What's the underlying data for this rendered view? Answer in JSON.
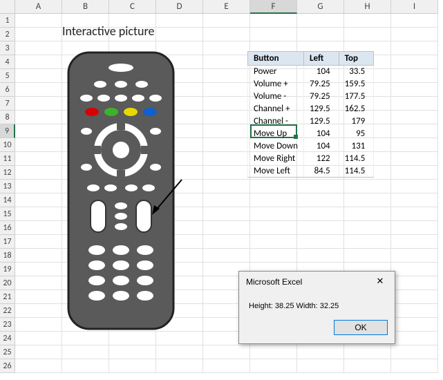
{
  "columns": [
    "A",
    "B",
    "C",
    "D",
    "E",
    "F",
    "G",
    "H",
    "I"
  ],
  "rowCount": 26,
  "activeCol": 5,
  "activeRow": 8,
  "title": "Interactive picture",
  "table": {
    "headers": [
      "Button",
      "Left",
      "Top"
    ],
    "rows": [
      {
        "button": "Power",
        "left": "104",
        "top": "33.5"
      },
      {
        "button": "Volume +",
        "left": "79.25",
        "top": "159.5"
      },
      {
        "button": "Volume -",
        "left": "79.25",
        "top": "177.5"
      },
      {
        "button": "Channel +",
        "left": "129.5",
        "top": "162.5"
      },
      {
        "button": "Channel -",
        "left": "129.5",
        "top": "179"
      },
      {
        "button": "Move Up",
        "left": "104",
        "top": "95"
      },
      {
        "button": "Move Down",
        "left": "104",
        "top": "131"
      },
      {
        "button": "Move Right",
        "left": "122",
        "top": "114.5"
      },
      {
        "button": "Move Left",
        "left": "84.5",
        "top": "114.5"
      }
    ]
  },
  "dialog": {
    "title": "Microsoft Excel",
    "body": "Height: 38.25 Width: 32.25",
    "ok": "OK"
  },
  "remote": {
    "colorButtons": [
      "#d80000",
      "#3cb32a",
      "#e8d800",
      "#1060d0"
    ]
  }
}
